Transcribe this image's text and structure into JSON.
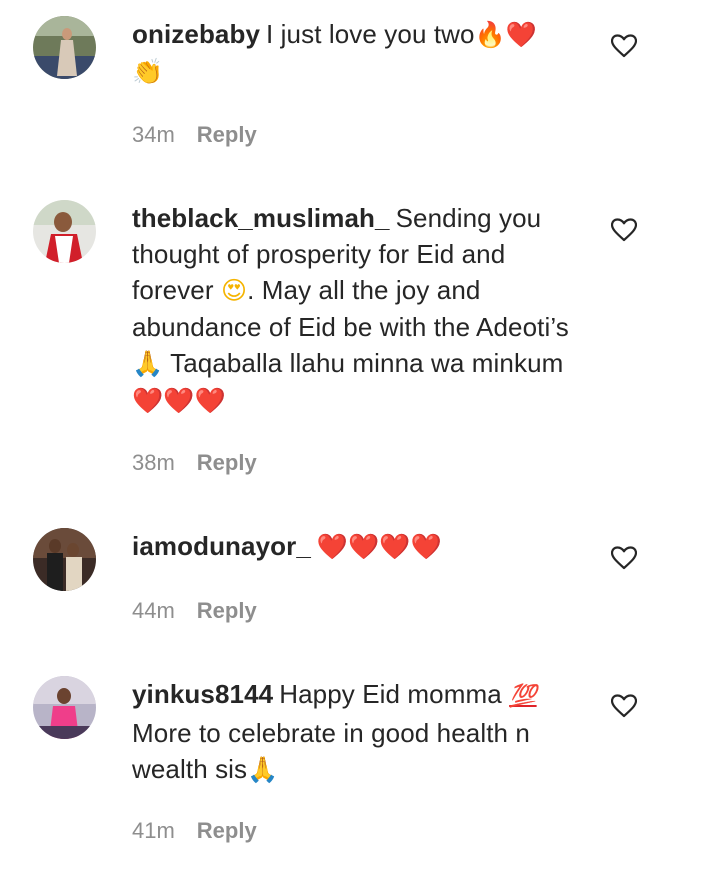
{
  "comments": [
    {
      "username": "onizebaby",
      "text": "I just love you two",
      "emoji_suffix": "🔥❤️",
      "emoji_line2": "👏",
      "time": "34m",
      "reply_label": "Reply"
    },
    {
      "username": "theblack_muslimah_",
      "text_part1": "Sending you thought of prosperity for Eid and forever",
      "emoji_face": "😍",
      "text_part2": ". May all the joy and abundance of Eid be with the Adeoti’s",
      "emoji_hands": "🙏",
      "text_part3": "Taqaballa llahu minna wa minkum",
      "emoji_hearts": "❤️❤️❤️",
      "time": "38m",
      "reply_label": "Reply"
    },
    {
      "username": "iamodunayor_",
      "emoji_hearts": "❤️❤️❤️❤️",
      "time": "44m",
      "reply_label": "Reply"
    },
    {
      "username": "yinkus8144",
      "text_part1": "Happy Eid momma",
      "emoji_hundred": "💯",
      "text_part2": "More to celebrate in good health n wealth sis",
      "emoji_hands": "🙏",
      "time": "41m",
      "reply_label": "Reply"
    }
  ],
  "icons": {
    "like": "heart-outline-icon"
  },
  "colors": {
    "text": "#262626",
    "meta": "#8e8e8e",
    "heart": "#e0242a"
  }
}
